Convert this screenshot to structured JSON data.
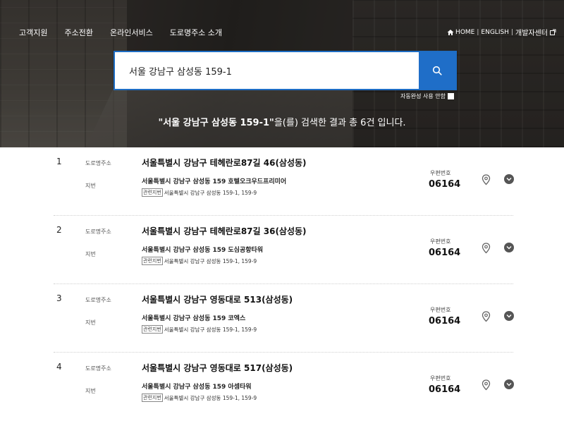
{
  "nav": {
    "items": [
      "고객지원",
      "주소전환",
      "온라인서비스",
      "도로명주소 소개"
    ]
  },
  "util": {
    "home": "HOME",
    "english": "ENGLISH",
    "dev_center": "개발자센터"
  },
  "search": {
    "value": "서울 강남구 삼성동 159-1",
    "autocomplete_label": "자동완성 사용 안함"
  },
  "summary": {
    "query_quoted": "\"서울 강남구 삼성동 159-1\"",
    "suffix": "을(를) 검색한 결과 총 6건 입니다."
  },
  "labels": {
    "road": "도로명주소",
    "jibun": "지번",
    "related_tag": "관련지번",
    "zip_label": "우편번호"
  },
  "results": [
    {
      "num": "1",
      "road_address": "서울특별시 강남구 테헤란로87길 46(삼성동)",
      "jibun_address": "서울특별시 강남구 삼성동 159 호텔오크우드프리미어",
      "related": "서울특별시 강남구 삼성동 159-1, 159-9",
      "zip": "06164"
    },
    {
      "num": "2",
      "road_address": "서울특별시 강남구 테헤란로87길 36(삼성동)",
      "jibun_address": "서울특별시 강남구 삼성동 159 도심공항타워",
      "related": "서울특별시 강남구 삼성동 159-1, 159-9",
      "zip": "06164"
    },
    {
      "num": "3",
      "road_address": "서울특별시 강남구 영동대로 513(삼성동)",
      "jibun_address": "서울특별시 강남구 삼성동 159 코엑스",
      "related": "서울특별시 강남구 삼성동 159-1, 159-9",
      "zip": "06164"
    },
    {
      "num": "4",
      "road_address": "서울특별시 강남구 영동대로 517(삼성동)",
      "jibun_address": "서울특별시 강남구 삼성동 159 아셈타워",
      "related": "서울특별시 강남구 삼성동 159-1, 159-9",
      "zip": "06164"
    }
  ],
  "colors": {
    "accent": "#1f6ec8",
    "search_border": "#1e6dc4"
  },
  "icons": [
    "home-icon",
    "external-link-icon",
    "search-icon",
    "map-pin-icon",
    "chevron-down-icon"
  ]
}
